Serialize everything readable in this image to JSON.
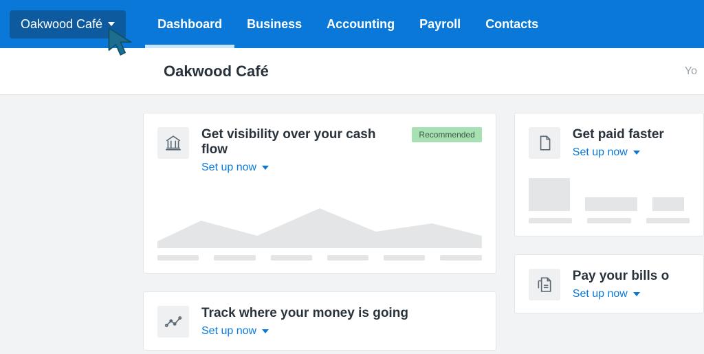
{
  "org_name": "Oakwood Café",
  "nav": {
    "items": [
      {
        "label": "Dashboard",
        "active": true
      },
      {
        "label": "Business",
        "active": false
      },
      {
        "label": "Accounting",
        "active": false
      },
      {
        "label": "Payroll",
        "active": false
      },
      {
        "label": "Contacts",
        "active": false
      }
    ]
  },
  "subheader": {
    "title": "Oakwood Café",
    "truncated_right": "Yo"
  },
  "cards": {
    "cashflow": {
      "title": "Get visibility over your cash flow",
      "action": "Set up now",
      "badge": "Recommended"
    },
    "getpaid": {
      "title": "Get paid faster",
      "action": "Set up now"
    },
    "track": {
      "title": "Track where your money is going",
      "action": "Set up now"
    },
    "paybills": {
      "title": "Pay your bills o",
      "action": "Set up now"
    }
  }
}
